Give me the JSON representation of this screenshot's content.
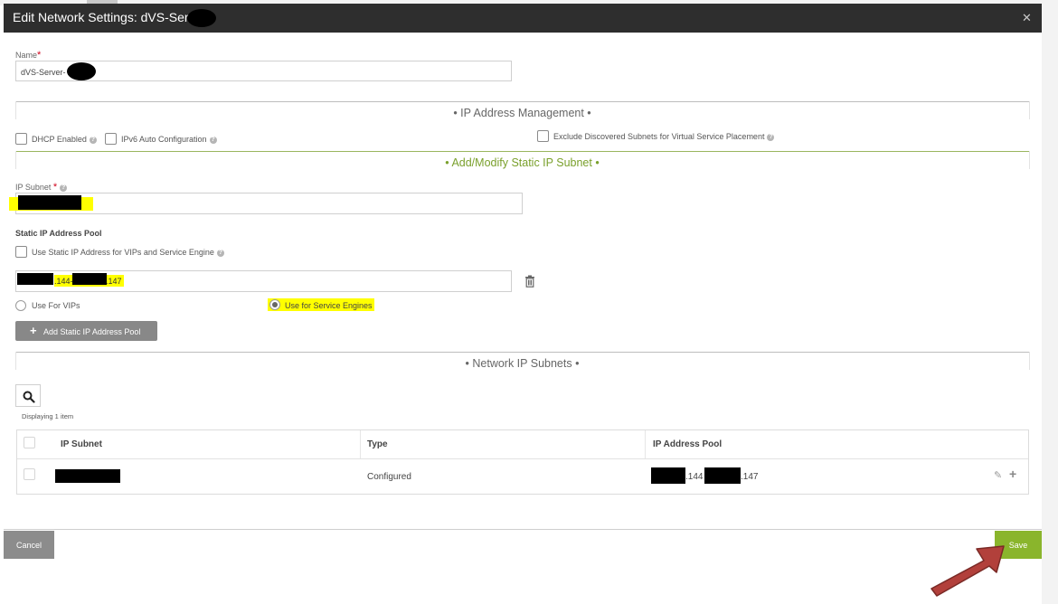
{
  "dialog": {
    "title": "Edit Network Settings: dVS-Server-",
    "close_icon": "close-icon"
  },
  "name_field": {
    "label": "Name",
    "required_mark": "*",
    "value": "dVS-Server-"
  },
  "ip_management": {
    "header": "• IP Address Management •",
    "dhcp_label": "DHCP Enabled",
    "ipv6_label": "IPv6 Auto Configuration",
    "exclude_label": "Exclude Discovered Subnets for Virtual Service Placement",
    "help_glyph": "?"
  },
  "static_subnet": {
    "header": "• Add/Modify Static IP Subnet •",
    "ip_subnet_label": "IP Subnet",
    "required_mark": "*",
    "pool_heading": "Static IP Address Pool",
    "use_static_label": "Use Static IP Address for VIPs and Service Engine",
    "pool_value_a": ".144-",
    "pool_value_b": ".147",
    "use_for_vips": "Use For VIPs",
    "use_for_se": "Use for Service Engines",
    "add_pool_icon": "+",
    "add_pool_label": "Add Static IP Address Pool"
  },
  "network_subnets": {
    "header": "• Network IP Subnets •",
    "displaying": "Displaying 1 item",
    "columns": [
      "IP Subnet",
      "Type",
      "IP Address Pool"
    ],
    "rows": [
      {
        "type": "Configured",
        "pool_a": ".144",
        "pool_b": ".147"
      }
    ],
    "edit_glyph": "✎",
    "add_glyph": "+"
  },
  "footer": {
    "cancel_label": "Cancel",
    "save_label": "Save"
  },
  "colors": {
    "titlebar": "#2e2e2e",
    "accent_green": "#8ab52c",
    "section_green": "#7aa02c",
    "highlight": "#ffff00",
    "annotation_arrow": "#b2403b"
  }
}
